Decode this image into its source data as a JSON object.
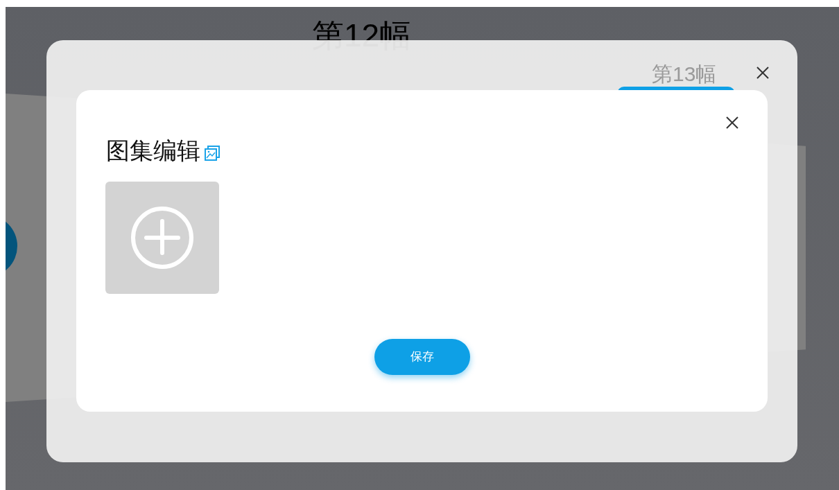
{
  "background_slides": [
    {
      "label": "第12幅"
    },
    {
      "label": "第13幅"
    }
  ],
  "dialog": {
    "title": "图集编辑",
    "save_button": "保存"
  }
}
